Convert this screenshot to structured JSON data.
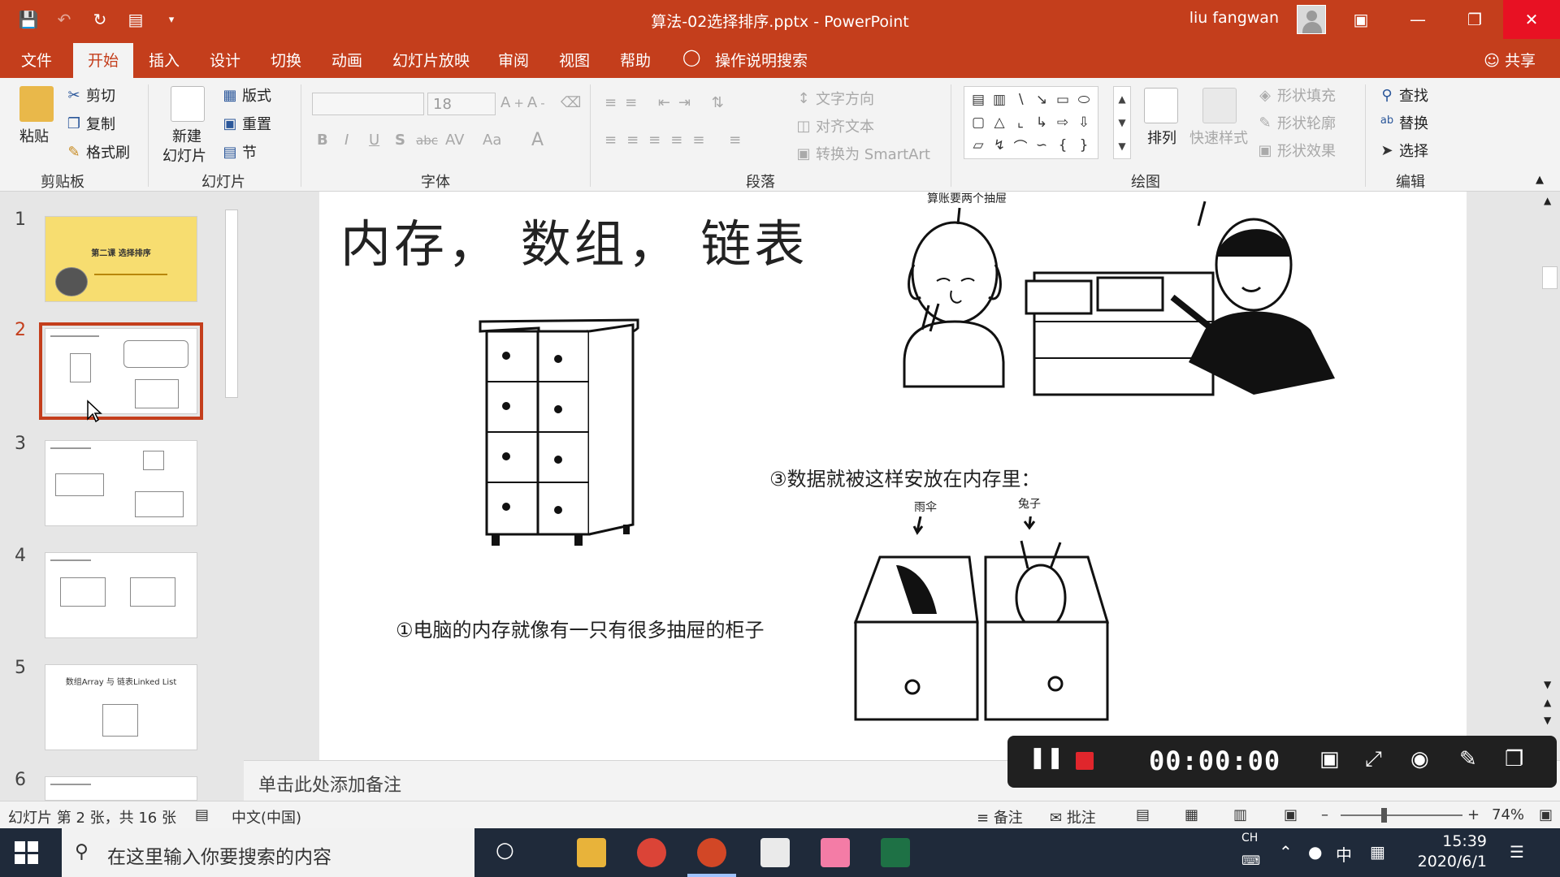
{
  "window": {
    "title": "算法-02选择排序.pptx  -  PowerPoint",
    "user": "liu fangwan",
    "quick_access": [
      "save-icon",
      "undo-icon",
      "redo-icon",
      "present-icon",
      "customize-icon"
    ]
  },
  "tabs": [
    "文件",
    "开始",
    "插入",
    "设计",
    "切换",
    "动画",
    "幻灯片放映",
    "审阅",
    "视图",
    "帮助"
  ],
  "active_tab": "开始",
  "tell_me": "操作说明搜索",
  "share": "共享",
  "ribbon": {
    "clipboard": {
      "paste": "粘贴",
      "cut": "剪切",
      "copy": "复制",
      "format_painter": "格式刷",
      "label": "剪贴板"
    },
    "slides": {
      "new_slide_1": "新建",
      "new_slide_2": "幻灯片",
      "layout": "版式",
      "reset": "重置",
      "section": "节",
      "label": "幻灯片"
    },
    "font": {
      "font_size": "18",
      "label": "字体",
      "bold": "B",
      "italic": "I",
      "underline": "U",
      "shadow": "S",
      "strike": "abc",
      "spacing": "AV",
      "case": "Aa",
      "color": "A"
    },
    "paragraph": {
      "text_direction": "文字方向",
      "align_text": "对齐文本",
      "smartart": "转换为 SmartArt",
      "label": "段落"
    },
    "drawing": {
      "arrange": "排列",
      "quick_styles": "快速样式",
      "shape_fill": "形状填充",
      "shape_outline": "形状轮廓",
      "shape_effects": "形状效果",
      "label": "绘图"
    },
    "editing": {
      "find": "查找",
      "replace": "替换",
      "select": "选择",
      "label": "编辑"
    }
  },
  "thumbnails": [
    {
      "num": "1",
      "title": "第二课 选择排序"
    },
    {
      "num": "2",
      "title": ""
    },
    {
      "num": "3",
      "title": ""
    },
    {
      "num": "4",
      "title": ""
    },
    {
      "num": "5",
      "title": "数组Array 与 链表Linked List"
    },
    {
      "num": "6",
      "title": ""
    }
  ],
  "slide": {
    "title": "内存，  数组，  链表",
    "caption1": "①电脑的内存就像有一只有很多抽屉的柜子",
    "caption3": "③数据就被这样安放在内存里：",
    "hand_top": "算账要两个抽屉",
    "hand_left": "雨伞",
    "hand_right": "兔子"
  },
  "notes_placeholder": "单击此处添加备注",
  "status": {
    "slide_info": "幻灯片 第 2 张，共 16 张",
    "language": "中文(中国)",
    "notes_btn": "备注",
    "comments_btn": "批注",
    "zoom": "74%"
  },
  "recorder": {
    "time": "00:00:00"
  },
  "taskbar": {
    "search_placeholder": "在这里输入你要搜索的内容",
    "ime_top": "CH",
    "ime_mode": "中",
    "time": "15:39",
    "date": "2020/6/1"
  },
  "colors": {
    "accent": "#c43e1c",
    "ribbon": "#f3f3f3",
    "taskbar": "#1f2a3a"
  }
}
